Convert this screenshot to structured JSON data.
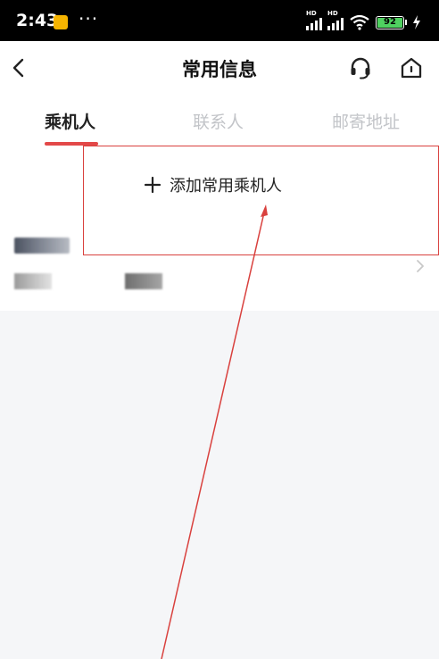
{
  "status_bar": {
    "time": "2:43",
    "dots": "···",
    "signal_1_label": "HD",
    "signal_2_label": "HD",
    "battery": "92",
    "app_icon": "notes-app-icon",
    "bolt_icon": "charging-bolt-icon"
  },
  "nav": {
    "title": "常用信息",
    "back_icon": "chevron-left-icon",
    "service_icon": "headset-icon",
    "home_icon": "home-icon"
  },
  "tabs": [
    {
      "label": "乘机人",
      "active": true
    },
    {
      "label": "联系人",
      "active": false
    },
    {
      "label": "邮寄地址",
      "active": false
    }
  ],
  "add_passenger": {
    "icon": "plus-icon",
    "label": "添加常用乘机人"
  },
  "passenger_list": {
    "row_chevron_icon": "chevron-right-icon"
  },
  "colors": {
    "accent": "#e34848",
    "annotation": "#d9413e",
    "tab_inactive": "#c2c4c8",
    "page_background": "#f5f6f8"
  }
}
